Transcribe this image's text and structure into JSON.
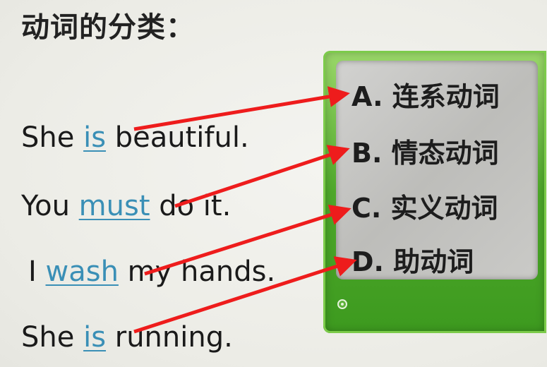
{
  "title": "动词的分类：",
  "sentences": [
    {
      "before": "She ",
      "verb": "is",
      "after": " beautiful."
    },
    {
      "before": "You ",
      "verb": "must",
      "after": " do it."
    },
    {
      "before": "I ",
      "verb": "wash",
      "after": " my hands."
    },
    {
      "before": "She ",
      "verb": "is",
      "after": " running."
    }
  ],
  "options": [
    "A. 连系动词",
    "B. 情态动词",
    "C. 实义动词",
    "D. 助动词"
  ],
  "colors": {
    "panel_green": "#4ea82a",
    "panel_inner": "#c6c6c3",
    "verb_highlight": "#3a8fb6",
    "arrow": "#ee1c1c"
  },
  "icons": [
    "arrow-icon",
    "radio-dot-icon"
  ]
}
